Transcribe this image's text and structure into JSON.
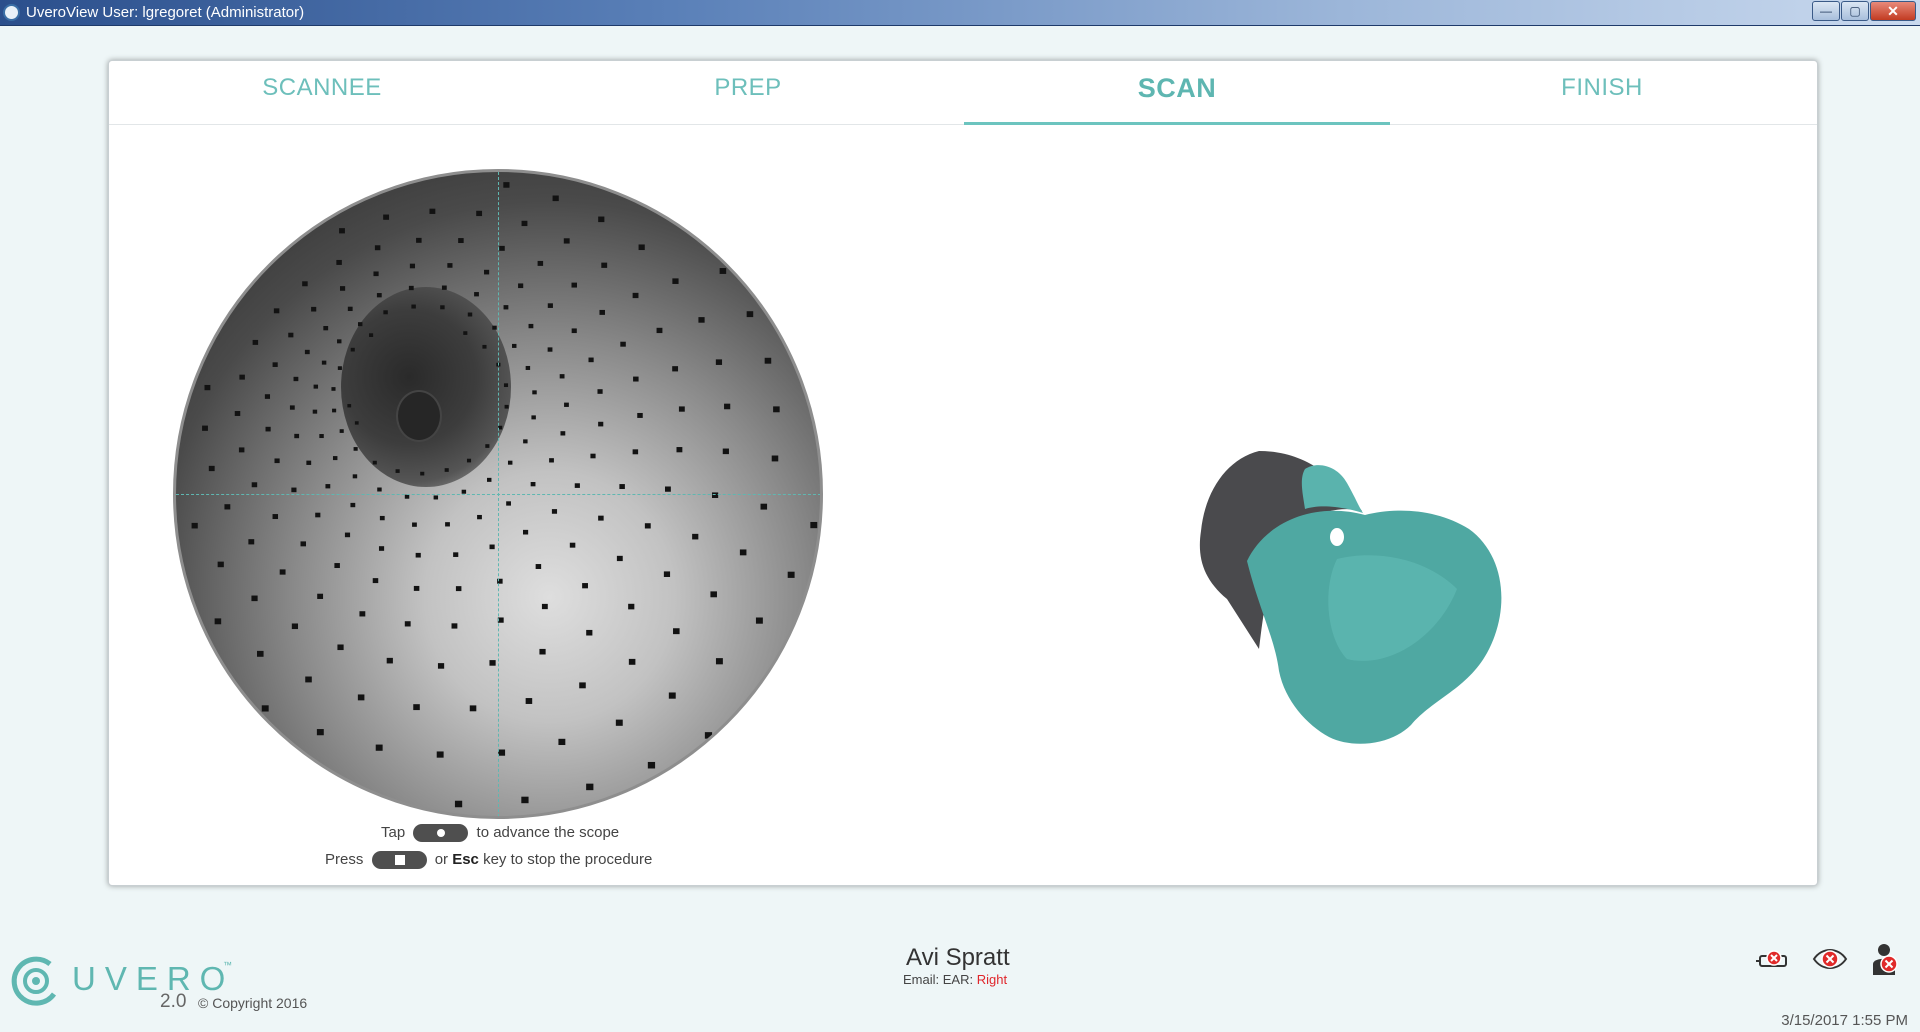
{
  "window": {
    "title": "UveroView User: lgregoret (Administrator)",
    "controls": {
      "minimize": "—",
      "maximize": "▢",
      "close": "✕"
    }
  },
  "tabs": [
    {
      "label": "SCANNEE",
      "active": false
    },
    {
      "label": "PREP",
      "active": false
    },
    {
      "label": "SCAN",
      "active": true
    },
    {
      "label": "FINISH",
      "active": false
    }
  ],
  "instructions": {
    "line1_prefix": "Tap",
    "line1_suffix": "to advance the scope",
    "line2_prefix": "Press",
    "line2_mid": "or",
    "line2_key": "Esc",
    "line2_suffix": "key to stop the procedure"
  },
  "footer": {
    "brand": "UVERO",
    "trademark": "™",
    "version": "2.0",
    "copyright": "© Copyright 2016",
    "patient_name": "Avi Spratt",
    "email_label": "Email:",
    "ear_label": "EAR:",
    "ear_value": "Right",
    "datetime": "3/15/2017 1:55 PM",
    "status_icons": [
      "camera-error-icon",
      "eye-error-icon",
      "user-error-icon"
    ],
    "status_error_color": "#e02a2a"
  },
  "colors": {
    "accent": "#5eb6b1",
    "model_fill": "#4fa8a2",
    "model_dark": "#4a4a4d"
  }
}
